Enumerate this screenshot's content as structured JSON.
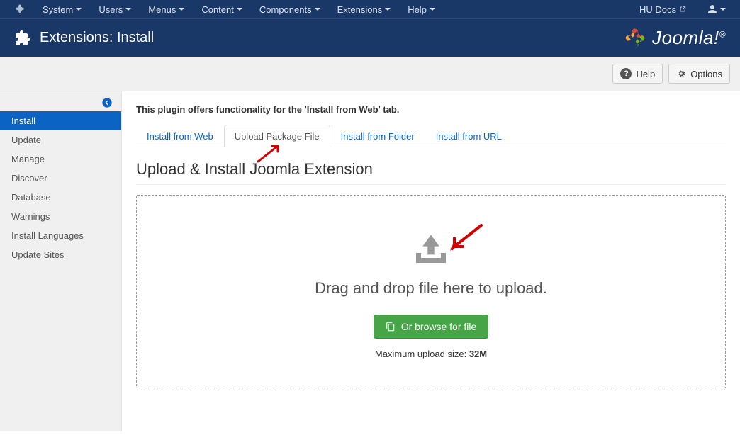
{
  "topnav": {
    "items": [
      "System",
      "Users",
      "Menus",
      "Content",
      "Components",
      "Extensions",
      "Help"
    ],
    "docs_label": "HU Docs"
  },
  "titlebar": {
    "title": "Extensions: Install",
    "brand": "Joomla!"
  },
  "toolbar": {
    "help_label": "Help",
    "options_label": "Options"
  },
  "sidebar": {
    "items": [
      "Install",
      "Update",
      "Manage",
      "Discover",
      "Database",
      "Warnings",
      "Install Languages",
      "Update Sites"
    ],
    "active_index": 0
  },
  "content": {
    "notice": "This plugin offers functionality for the 'Install from Web' tab.",
    "tabs": [
      "Install from Web",
      "Upload Package File",
      "Install from Folder",
      "Install from URL"
    ],
    "active_tab_index": 1,
    "section_title": "Upload & Install Joomla Extension",
    "dropzone_text": "Drag and drop file here to upload.",
    "browse_label": "Or browse for file",
    "maxsize_label": "Maximum upload size: ",
    "maxsize_value": "32M"
  }
}
